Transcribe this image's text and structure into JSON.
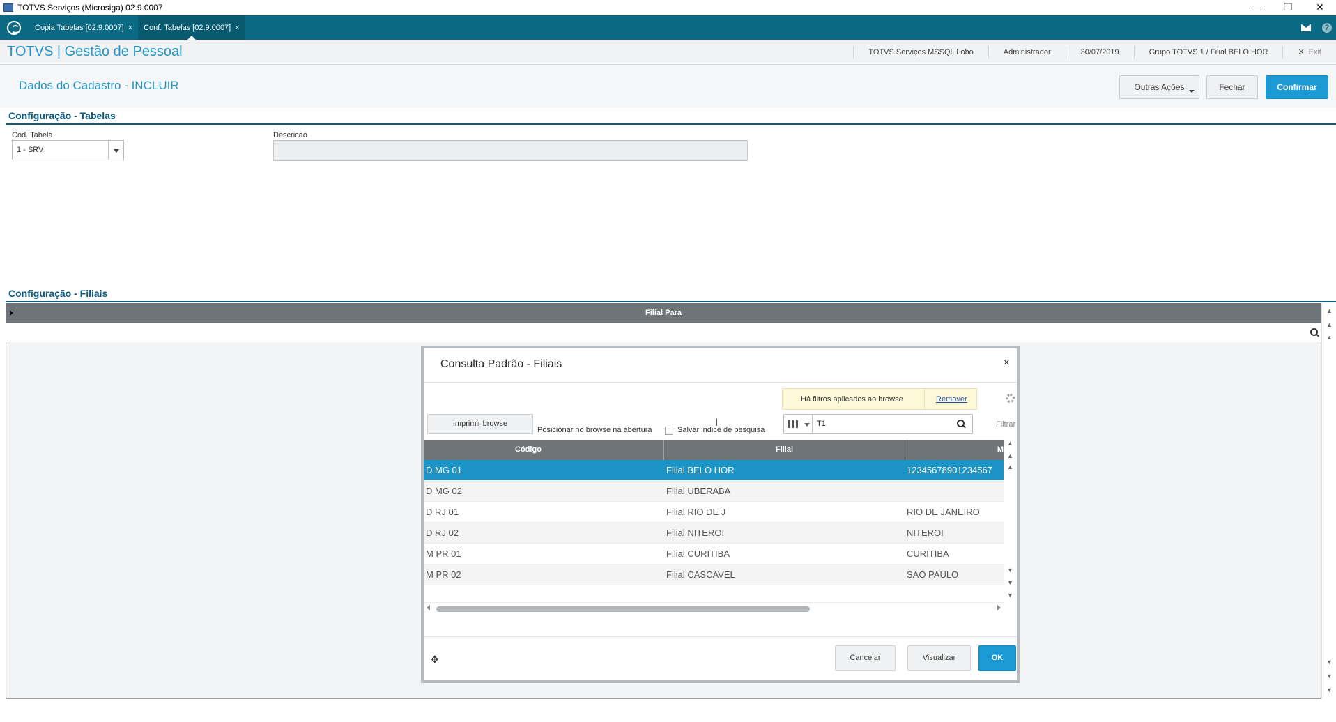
{
  "window": {
    "title": "TOTVS Serviços (Microsiga) 02.9.0007",
    "controls": {
      "minimize": "—",
      "restore": "❐",
      "close": "✕"
    }
  },
  "tabs": [
    {
      "label": "Copia Tabelas [02.9.0007]",
      "close": "×"
    },
    {
      "label": "Conf. Tabelas [02.9.0007]",
      "close": "×"
    }
  ],
  "header": {
    "brand": "TOTVS | Gestão de Pessoal",
    "env": "TOTVS Serviços MSSQL Lobo",
    "user": "Administrador",
    "date": "30/07/2019",
    "branch": "Grupo TOTVS 1 / Filial BELO HOR",
    "exit": "Exit",
    "exit_icon": "✕"
  },
  "page": {
    "title": "Dados do Cadastro - INCLUIR",
    "buttons": {
      "other_actions": "Outras Ações",
      "close": "Fechar",
      "confirm": "Confirmar"
    }
  },
  "section_tabelas": {
    "title": "Configuração - Tabelas",
    "cod_label": "Cod. Tabela",
    "cod_value": "1 - SRV",
    "desc_label": "Descricao",
    "desc_value": ""
  },
  "section_filiais": {
    "title": "Configuração - Filiais",
    "grid_header": "Filial Para"
  },
  "modal": {
    "title": "Consulta Padrão - Filiais",
    "close": "×",
    "filter_note": "Há filtros aplicados ao browse",
    "remove_link": "Remover",
    "print_button": "Imprimir browse",
    "position_label": "Posicionar no browse na abertura",
    "save_index_label": "Salvar indice de pesquisa",
    "save_index_checked": false,
    "search_value": "T1",
    "filter_label": "Filtrar",
    "columns": [
      "Código",
      "Filial",
      "M"
    ],
    "rows": [
      {
        "codigo": "D MG 01",
        "filial": "Filial BELO HOR",
        "extra": "12345678901234567",
        "selected": true
      },
      {
        "codigo": "D MG 02",
        "filial": "Filial UBERABA",
        "extra": ""
      },
      {
        "codigo": "D RJ 01",
        "filial": "Filial RIO DE J",
        "extra": "RIO DE JANEIRO"
      },
      {
        "codigo": "D RJ 02",
        "filial": "Filial NITEROI",
        "extra": "NITEROI"
      },
      {
        "codigo": "M PR 01",
        "filial": "Filial CURITIBA",
        "extra": "CURITIBA"
      },
      {
        "codigo": "M PR 02",
        "filial": "Filial CASCAVEL",
        "extra": "SAO PAULO"
      }
    ],
    "footer": {
      "cancel": "Cancelar",
      "view": "Visualizar",
      "ok": "OK",
      "move_icon": "✥"
    }
  },
  "colors": {
    "brand_teal": "#0b6a83",
    "accent_blue": "#1c9ad6",
    "section_navy": "#0c5b80",
    "selection": "#1c94c6"
  }
}
